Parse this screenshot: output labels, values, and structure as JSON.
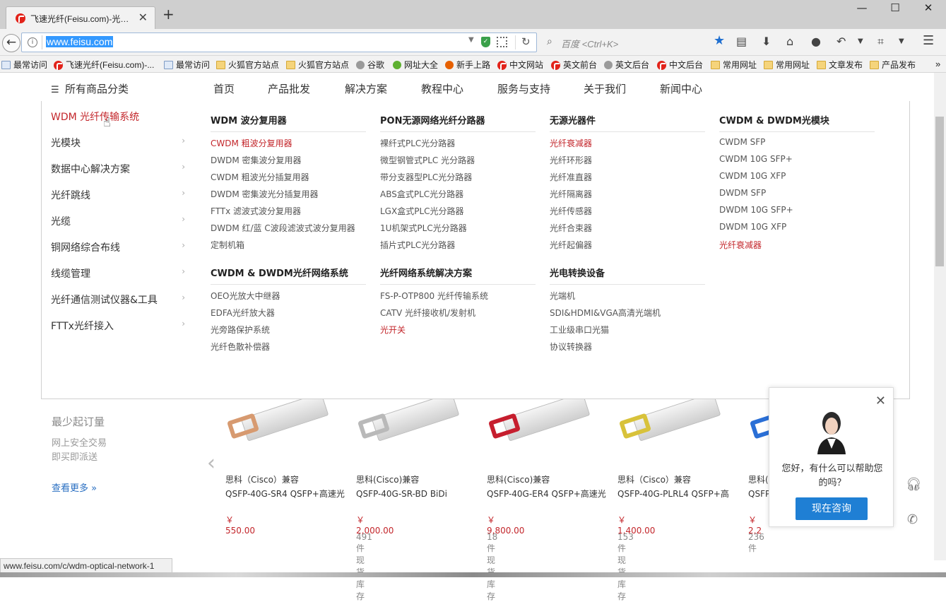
{
  "browser": {
    "tab_title": "飞速光纤(Feisu.com)-光…",
    "tab_close": "✕",
    "new_tab": "+",
    "url": "www.feisu.com",
    "search_placeholder": "百度 <Ctrl+K>",
    "window_controls": [
      "—",
      "☐",
      "✕"
    ],
    "bookmarks": [
      {
        "label": "最常访问",
        "icon": "page"
      },
      {
        "label": "飞速光纤(Feisu.com)-...",
        "icon": "feisu"
      },
      {
        "label": "最常访问",
        "icon": "page"
      },
      {
        "label": "火狐官方站点",
        "icon": "folder"
      },
      {
        "label": "火狐官方站点",
        "icon": "folder"
      },
      {
        "label": "谷歌",
        "icon": "globe"
      },
      {
        "label": "网址大全",
        "icon": "green"
      },
      {
        "label": "新手上路",
        "icon": "firefox"
      },
      {
        "label": "中文网站",
        "icon": "feisu"
      },
      {
        "label": "英文前台",
        "icon": "feisu"
      },
      {
        "label": "英文后台",
        "icon": "globe"
      },
      {
        "label": "中文后台",
        "icon": "feisu"
      },
      {
        "label": "常用网址",
        "icon": "folder"
      },
      {
        "label": "常用网址",
        "icon": "folder"
      },
      {
        "label": "文章发布",
        "icon": "folder"
      },
      {
        "label": "产品发布",
        "icon": "folder"
      }
    ],
    "bookmarks_overflow": "»",
    "status_url": "www.feisu.com/c/wdm-optical-network-1"
  },
  "site_nav": {
    "all_categories": "所有商品分类",
    "items": [
      "首页",
      "产品批发",
      "解决方案",
      "教程中心",
      "服务与支持",
      "关于我们",
      "新闻中心"
    ]
  },
  "categories": [
    {
      "label": "WDM 光纤传输系统",
      "active": true
    },
    {
      "label": "光模块"
    },
    {
      "label": "数据中心解决方案"
    },
    {
      "label": "光纤跳线"
    },
    {
      "label": "光缆"
    },
    {
      "label": "铜网络综合布线"
    },
    {
      "label": "线缆管理"
    },
    {
      "label": "光纤通信测试仪器&工具"
    },
    {
      "label": "FTTx光纤接入"
    }
  ],
  "menu_columns": [
    {
      "title": "WDM 波分复用器",
      "links": [
        "CWDM 粗波分复用器",
        "DWDM 密集波分复用器",
        "CWDM 粗波光分插复用器",
        "DWDM 密集波光分插复用器",
        "FTTx 滤波式波分复用器",
        "DWDM 红/蓝 C波段滤波式波分复用器",
        "定制机箱"
      ],
      "highlight": [
        0
      ]
    },
    {
      "title": "PON无源网络光纤分路器",
      "links": [
        "裸纤式PLC光分路器",
        "微型钢管式PLC 光分路器",
        "带分支器型PLC光分路器",
        "ABS盒式PLC光分路器",
        "LGX盒式PLC光分路器",
        "1U机架式PLC光分路器",
        "插片式PLC光分路器"
      ],
      "highlight": []
    },
    {
      "title": "无源光器件",
      "links": [
        "光纤衰减器",
        "光纤环形器",
        "光纤准直器",
        "光纤隔离器",
        "光纤传感器",
        "光纤合束器",
        "光纤起偏器"
      ],
      "highlight": [
        0
      ]
    },
    {
      "title": "CWDM & DWDM光模块",
      "links": [
        "CWDM SFP",
        "CWDM 10G SFP+",
        "CWDM 10G XFP",
        "DWDM SFP",
        "DWDM 10G SFP+",
        "DWDM 10G XFP",
        "光纤衰减器"
      ],
      "highlight": [
        6
      ]
    },
    {
      "title": "CWDM & DWDM光纤网络系统",
      "links": [
        "OEO光放大中继器",
        "EDFA光纤放大器",
        "光旁路保护系统",
        "光纤色散补偿器"
      ],
      "highlight": []
    },
    {
      "title": "光纤网络系统解决方案",
      "links": [
        "FS-P-OTP800 光纤传输系统",
        "CATV 光纤接收机/发射机",
        "光开关"
      ],
      "highlight": [
        2
      ]
    },
    {
      "title": "光电转换设备",
      "links": [
        "光端机",
        "SDI&HDMI&VGA高清光端机",
        "工业级串口光猫",
        "协议转换器"
      ],
      "highlight": []
    }
  ],
  "left_panel": {
    "min_order": "最少起订量",
    "line1": "网上安全交易",
    "line2": "即买即派送",
    "see_more": "查看更多 »",
    "prev": "‹"
  },
  "products": [
    {
      "name1": "思科（Cisco）兼容",
      "name2": "QSFP-40G-SR4 QSFP+高速光",
      "price": "￥ 550.00",
      "stock": "",
      "latch": "#d79a70"
    },
    {
      "name1": "思科(Cisco)兼容",
      "name2": "QSFP-40G-SR-BD BiDi",
      "price": "￥ 2,000.00",
      "stock": "491 件 现货库存",
      "latch": "#b9b9b9"
    },
    {
      "name1": "思科(Cisco)兼容",
      "name2": "QSFP-40G-ER4 QSFP+高速光",
      "price": "￥ 9,800.00",
      "stock": "18 件 现货库存",
      "latch": "#c61e2e"
    },
    {
      "name1": "思科（Cisco）兼容",
      "name2": "QSFP-40G-PLRL4 QSFP+高",
      "price": "￥ 1,400.00",
      "stock": "153 件 现货库存",
      "latch": "#d8c23a"
    },
    {
      "name1": "思科(",
      "name2": "QSFP",
      "price": "￥ 2,2",
      "stock": "236 件",
      "latch": "#2a6fd6"
    }
  ],
  "chat": {
    "close": "✕",
    "greeting": "您好，有什么可以帮助您的吗？",
    "button": "现在咨询"
  }
}
